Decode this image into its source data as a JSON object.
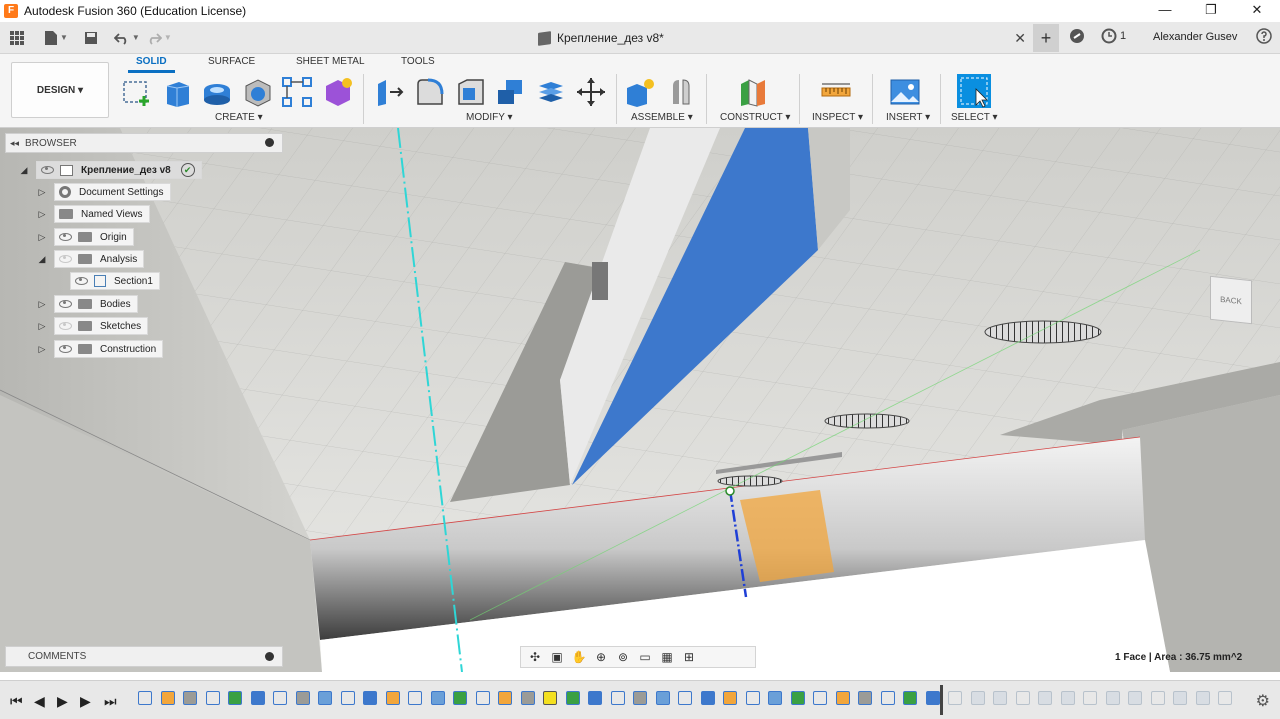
{
  "window": {
    "title": "Autodesk Fusion 360 (Education License)",
    "logo_letter": "F",
    "minimize": "—",
    "maximize": "❐",
    "close": "✕"
  },
  "quick_access": {
    "document_title": "Крепление_дез v8*",
    "add_tab": "+",
    "job_count": "1",
    "user": "Alexander Gusev",
    "close_tab": "✕"
  },
  "ribbon": {
    "workspace": "DESIGN ▾",
    "tabs": [
      "SOLID",
      "SURFACE",
      "SHEET METAL",
      "TOOLS"
    ],
    "groups": [
      "CREATE ▾",
      "MODIFY ▾",
      "ASSEMBLE ▾",
      "CONSTRUCT ▾",
      "INSPECT ▾",
      "INSERT ▾",
      "SELECT ▾"
    ]
  },
  "browser": {
    "header": "BROWSER",
    "root": "Крепление_дез v8",
    "items": [
      {
        "label": "Document Settings"
      },
      {
        "label": "Named Views"
      },
      {
        "label": "Origin"
      },
      {
        "label": "Analysis"
      },
      {
        "label": "Section1"
      },
      {
        "label": "Bodies"
      },
      {
        "label": "Sketches"
      },
      {
        "label": "Construction"
      }
    ]
  },
  "comments": {
    "header": "COMMENTS"
  },
  "status": {
    "selection": "1 Face | Area : 36.75 mm^2"
  },
  "viewcube": {
    "face": "BACK"
  },
  "colors": {
    "accent": "#0a6fc2",
    "selection_face": "#3d78cc",
    "highlight_face": "#f2a63c",
    "axis_cyan": "#2fd6d6"
  }
}
